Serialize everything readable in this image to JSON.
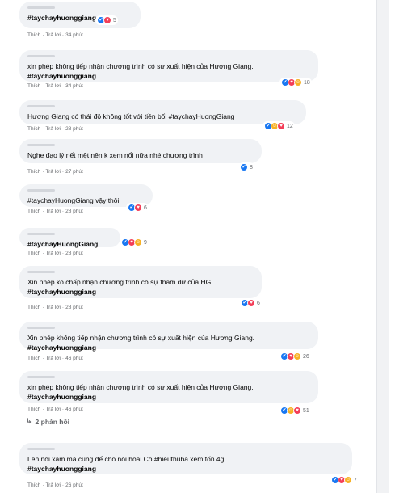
{
  "colors": {
    "like": "#1877f2",
    "love": "#f33e58",
    "haha": "#f7b125",
    "meta": "#65676b",
    "bubble": "#f0f2f5"
  },
  "meta_like": "Thích",
  "meta_reply": "Trả lời",
  "comments": [
    {
      "lines": [],
      "tag": "#taychayhuonggiang",
      "time": "34 phút",
      "reactions": [
        "like",
        "love"
      ],
      "count": "5"
    },
    {
      "lines": [
        "xin phép không tiếp nhận chương trình có sự xuất hiện của Hương Giang."
      ],
      "tag": "#taychayhuonggiang",
      "time": "34 phút",
      "reactions": [
        "like",
        "love",
        "haha"
      ],
      "count": "18"
    },
    {
      "lines": [
        "Hương Giang có thái độ không tốt với tiền bối #taychayHuongGiang"
      ],
      "tag": "",
      "time": "28 phút",
      "reactions": [
        "like",
        "haha",
        "love"
      ],
      "count": "12"
    },
    {
      "lines": [
        "Nghe đạo lý nết mệt nên k xem nổi nữa nhé chương trình"
      ],
      "tag": "",
      "time": "27 phút",
      "reactions": [
        "like"
      ],
      "count": "8"
    },
    {
      "lines": [
        "#taychayHuongGiang vậy thôi"
      ],
      "tag": "",
      "time": "28 phút",
      "reactions": [
        "like",
        "love"
      ],
      "count": "6"
    },
    {
      "lines": [],
      "tag": "#taychayHuongGiang",
      "time": "28 phút",
      "reactions": [
        "like",
        "love",
        "haha"
      ],
      "count": "9"
    },
    {
      "lines": [
        "Xin phép ko chấp nhận chương trình có sự tham dự của HG."
      ],
      "tag": "#taychayhuonggiang",
      "time": "28 phút",
      "reactions": [
        "like",
        "love"
      ],
      "count": "6"
    },
    {
      "lines": [
        "Xin phép không tiếp nhận chương trình có sự xuất hiện của Hương Giang."
      ],
      "tag": "#taychayhuonggiang",
      "time": "46 phút",
      "reactions": [
        "like",
        "love",
        "haha"
      ],
      "count": "26"
    },
    {
      "lines": [
        "xin phép không tiếp nhận chương trình có sự xuất hiện của Hương Giang."
      ],
      "tag": "#taychayhuonggiang",
      "time": "46 phút",
      "reactions": [
        "like",
        "haha",
        "love"
      ],
      "count": "51"
    },
    {
      "lines": [
        "Lên nói xàm mà cũng để cho nói hoài Có #hieuthuba xem tốn 4g"
      ],
      "tag": "#taychayhuonggiang",
      "time": "26 phút",
      "reactions": [
        "like",
        "love",
        "haha"
      ],
      "count": "7"
    }
  ],
  "replies_label": "2 phản hồi"
}
